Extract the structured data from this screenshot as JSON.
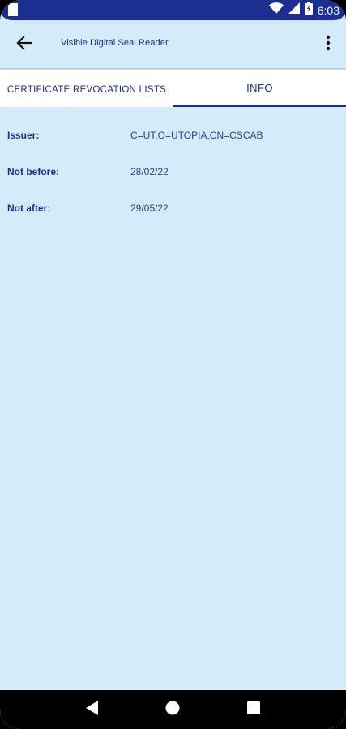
{
  "status_bar": {
    "time": "6:03"
  },
  "app_bar": {
    "title": "Visible Digital Seal Reader"
  },
  "tabs": [
    {
      "label": "CERTIFICATE REVOCATION LISTS",
      "selected": false
    },
    {
      "label": "INFO",
      "selected": true
    }
  ],
  "info": {
    "issuer_label": "Issuer:",
    "issuer_value": "C=UT,O=UTOPIA,CN=CSCAB",
    "not_before_label": "Not before:",
    "not_before_value": "28/02/22",
    "not_after_label": "Not after:",
    "not_after_value": "29/05/22"
  },
  "icons": {
    "back": "arrow-back-icon",
    "more": "more-vert-icon",
    "wifi": "wifi-icon",
    "signal": "signal-icon",
    "battery": "battery-icon",
    "nav_back": "nav-back-icon",
    "nav_home": "nav-home-icon",
    "nav_recents": "nav-recents-icon"
  },
  "colors": {
    "primary": "#1c2e8f",
    "background": "#d4ecfa",
    "tab_background": "#ffffff"
  }
}
